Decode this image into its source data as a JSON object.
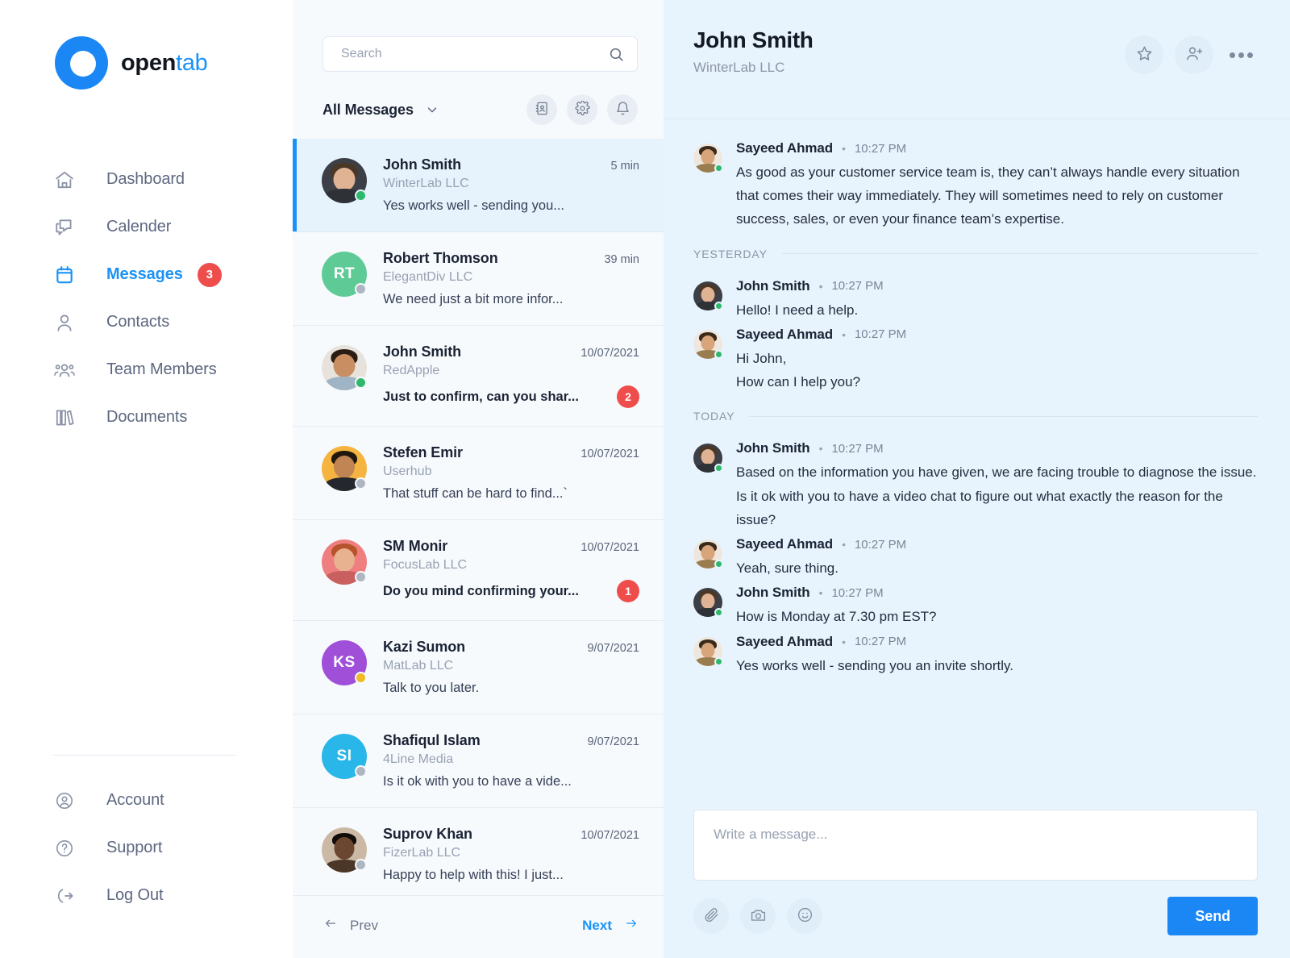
{
  "brand": {
    "name_bold": "open",
    "name_light": "tab"
  },
  "sidebar": {
    "items": [
      {
        "label": "Dashboard",
        "icon": "home-icon",
        "active": false,
        "badge": ""
      },
      {
        "label": "Calender",
        "icon": "chat-icon",
        "active": false,
        "badge": ""
      },
      {
        "label": "Messages",
        "icon": "calendar-icon",
        "active": true,
        "badge": "3"
      },
      {
        "label": "Contacts",
        "icon": "user-icon",
        "active": false,
        "badge": ""
      },
      {
        "label": "Team Members",
        "icon": "users-icon",
        "active": false,
        "badge": ""
      },
      {
        "label": "Documents",
        "icon": "books-icon",
        "active": false,
        "badge": ""
      }
    ],
    "bottom_items": [
      {
        "label": "Account",
        "icon": "account-circle-icon"
      },
      {
        "label": "Support",
        "icon": "question-circle-icon"
      },
      {
        "label": "Log Out",
        "icon": "logout-icon"
      }
    ]
  },
  "list_panel": {
    "search": {
      "value": "",
      "placeholder": "Search",
      "icon": "search-icon"
    },
    "filter_label": "All Messages",
    "filter_chevron": "chevron-down-icon",
    "actions": [
      {
        "name": "contacts-book-button",
        "icon": "address-book-icon"
      },
      {
        "name": "settings-button",
        "icon": "gear-icon"
      },
      {
        "name": "notifications-button",
        "icon": "bell-icon"
      }
    ],
    "conversations": [
      {
        "name": "John Smith",
        "company": "WinterLab LLC",
        "time": "5 min",
        "preview": "Yes works well - sending you...",
        "unread": "",
        "bold": false,
        "active": true,
        "status": "online",
        "avatar": {
          "type": "photo",
          "bg": "#3c3f45",
          "skin": "#e0b394",
          "hair": "#4a3726"
        }
      },
      {
        "name": "Robert Thomson",
        "company": "ElegantDiv LLC",
        "time": "39 min",
        "preview": "We need just a bit more infor...",
        "unread": "",
        "bold": false,
        "active": false,
        "status": "offline",
        "avatar": {
          "type": "initials",
          "initials": "RT",
          "bg": "#5ecb96"
        }
      },
      {
        "name": "John Smith",
        "company": "RedApple",
        "time": "10/07/2021",
        "preview": "Just to confirm, can you shar...",
        "unread": "2",
        "bold": true,
        "active": false,
        "status": "online",
        "avatar": {
          "type": "photo",
          "bg": "#e7e2dc",
          "skin": "#c98f63",
          "hair": "#2b1d13"
        }
      },
      {
        "name": "Stefen Emir",
        "company": "Userhub",
        "time": "10/07/2021",
        "preview": "That stuff can be hard to find...`",
        "unread": "",
        "bold": false,
        "active": false,
        "status": "offline",
        "avatar": {
          "type": "photo",
          "bg": "#f5b43f",
          "skin": "#c08553",
          "hair": "#20180f"
        }
      },
      {
        "name": "SM Monir",
        "company": "FocusLab LLC",
        "time": "10/07/2021",
        "preview": "Do you mind confirming your...",
        "unread": "1",
        "bold": true,
        "active": false,
        "status": "offline",
        "avatar": {
          "type": "photo",
          "bg": "#ef7e7e",
          "skin": "#e8b190",
          "hair": "#b5542a"
        }
      },
      {
        "name": "Kazi Sumon",
        "company": "MatLab LLC",
        "time": "9/07/2021",
        "preview": "Talk to you later.",
        "unread": "",
        "bold": false,
        "active": false,
        "status": "away",
        "avatar": {
          "type": "initials",
          "initials": "KS",
          "bg": "#a050d8"
        }
      },
      {
        "name": "Shafiqul Islam",
        "company": "4Line Media",
        "time": "9/07/2021",
        "preview": "Is it ok with you to have a vide...",
        "unread": "",
        "bold": false,
        "active": false,
        "status": "offline",
        "avatar": {
          "type": "initials",
          "initials": "SI",
          "bg": "#29b6e8"
        }
      },
      {
        "name": "Suprov Khan",
        "company": "FizerLab LLC",
        "time": "10/07/2021",
        "preview": "Happy to help with this! I just...",
        "unread": "",
        "bold": false,
        "active": false,
        "status": "offline",
        "avatar": {
          "type": "photo",
          "bg": "#cbb9a6",
          "skin": "#6b4630",
          "hair": "#120c08"
        }
      }
    ],
    "pager": {
      "prev_label": "Prev",
      "next_label": "Next",
      "prev_icon": "arrow-left-icon",
      "next_icon": "arrow-right-icon"
    }
  },
  "chat": {
    "title": "John Smith",
    "subtitle": "WinterLab LLC",
    "actions": [
      {
        "name": "favorite-button",
        "icon": "star-icon"
      },
      {
        "name": "add-person-button",
        "icon": "user-plus-icon"
      },
      {
        "name": "more-options-button",
        "icon": "ellipsis-icon"
      }
    ],
    "messages": [
      {
        "kind": "message",
        "sender": "Sayeed Ahmad",
        "time": "10:27 PM",
        "status": "online",
        "avatar": {
          "type": "photo",
          "bg": "#efe7dd",
          "skin": "#d8a47a",
          "hair": "#3a2a1c"
        },
        "text": "As good as your customer service team is, they can’t always handle every situation that comes their way immediately. They will sometimes need to rely on customer success, sales, or even your finance team’s expertise."
      },
      {
        "kind": "divider",
        "label": "YESTERDAY"
      },
      {
        "kind": "message",
        "sender": "John Smith",
        "time": "10:27 PM",
        "status": "online",
        "avatar": {
          "type": "photo",
          "bg": "#3c3f45",
          "skin": "#e0b394",
          "hair": "#4a3726"
        },
        "text": "Hello! I need a help."
      },
      {
        "kind": "message",
        "sender": "Sayeed Ahmad",
        "time": "10:27 PM",
        "status": "online",
        "avatar": {
          "type": "photo",
          "bg": "#efe7dd",
          "skin": "#d8a47a",
          "hair": "#3a2a1c"
        },
        "text": "Hi John,\nHow can I help you?"
      },
      {
        "kind": "divider",
        "label": "TODAY"
      },
      {
        "kind": "message",
        "sender": "John Smith",
        "time": "10:27 PM",
        "status": "online",
        "avatar": {
          "type": "photo",
          "bg": "#3c3f45",
          "skin": "#e0b394",
          "hair": "#4a3726"
        },
        "text": "Based on the information you have given, we are facing trouble to diagnose the issue. Is it ok with you to have a video chat to figure out what exactly the reason for the issue?"
      },
      {
        "kind": "message",
        "sender": "Sayeed Ahmad",
        "time": "10:27 PM",
        "status": "online",
        "avatar": {
          "type": "photo",
          "bg": "#efe7dd",
          "skin": "#d8a47a",
          "hair": "#3a2a1c"
        },
        "text": "Yeah, sure thing."
      },
      {
        "kind": "message",
        "sender": "John Smith",
        "time": "10:27 PM",
        "status": "online",
        "avatar": {
          "type": "photo",
          "bg": "#3c3f45",
          "skin": "#e0b394",
          "hair": "#4a3726"
        },
        "text": "How is Monday at 7.30 pm EST?"
      },
      {
        "kind": "message",
        "sender": "Sayeed Ahmad",
        "time": "10:27 PM",
        "status": "online",
        "avatar": {
          "type": "photo",
          "bg": "#efe7dd",
          "skin": "#d8a47a",
          "hair": "#3a2a1c"
        },
        "text": "Yes works well - sending you an invite shortly."
      }
    ],
    "composer": {
      "value": "",
      "placeholder": "Write a message...",
      "tools": [
        {
          "name": "attach-file-button",
          "icon": "paperclip-icon"
        },
        {
          "name": "camera-button",
          "icon": "camera-icon"
        },
        {
          "name": "emoji-button",
          "icon": "smiley-icon"
        }
      ],
      "send_label": "Send"
    }
  },
  "colors": {
    "accent": "#1b92f5",
    "badge_red": "#ef4c4c",
    "online_green": "#2eb86a",
    "away_yellow": "#f2b927",
    "offline_gray": "#aeb6c2",
    "chat_bg": "#e8f4fd",
    "list_bg": "#f7fafd"
  }
}
